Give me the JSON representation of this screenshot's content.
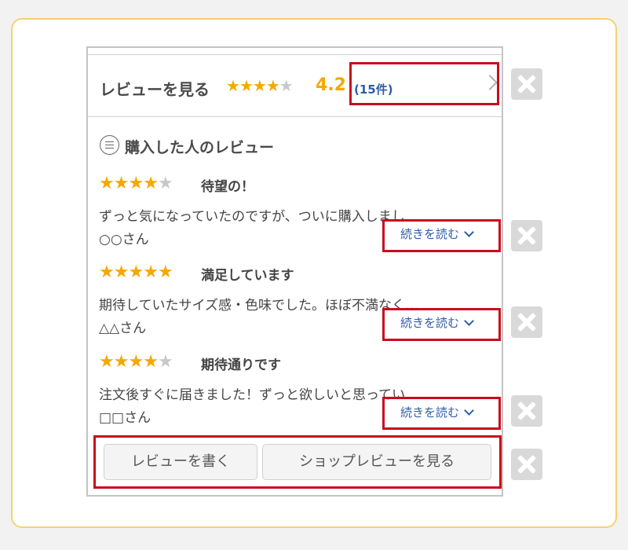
{
  "header": {
    "title": "レビューを見る",
    "stars": [
      "★",
      "★",
      "★",
      "★",
      "★"
    ],
    "rating": "4.2",
    "count": "(15件)"
  },
  "section": {
    "title": "購入した人のレビュー"
  },
  "reviews": [
    {
      "stars": [
        "★",
        "★",
        "★",
        "★",
        "★"
      ],
      "star_rating": 4,
      "title": "待望の！",
      "body": "ずっと気になっていたのですが、ついに購入しまし…",
      "author": "○○さん",
      "more_label": "続きを読む"
    },
    {
      "stars": [
        "★",
        "★",
        "★",
        "★",
        "★"
      ],
      "star_rating": 5,
      "title": "満足しています",
      "body": "期待していたサイズ感・色味でした。ほぼ不満なく…",
      "author": "△△さん",
      "more_label": "続きを読む"
    },
    {
      "stars": [
        "★",
        "★",
        "★",
        "★",
        "★"
      ],
      "star_rating": 4,
      "title": "期待通りです",
      "body": "注文後すぐに届きました！ずっと欲しいと思ってい…",
      "author": "□□さん",
      "more_label": "続きを読む"
    }
  ],
  "buttons": {
    "write_review": "レビューを書く",
    "shop_review": "ショップレビューを見る"
  },
  "colors": {
    "star_on": "#f5a800",
    "star_off": "#c8c8c8",
    "link": "#2e5da8",
    "highlight": "#c80d1e",
    "outer_border": "#f5d36b"
  },
  "icons": {
    "section": "message-list-icon",
    "header_arrow": "chevron-right-icon",
    "more_arrow": "chevron-down-icon",
    "remove": "close-icon"
  }
}
